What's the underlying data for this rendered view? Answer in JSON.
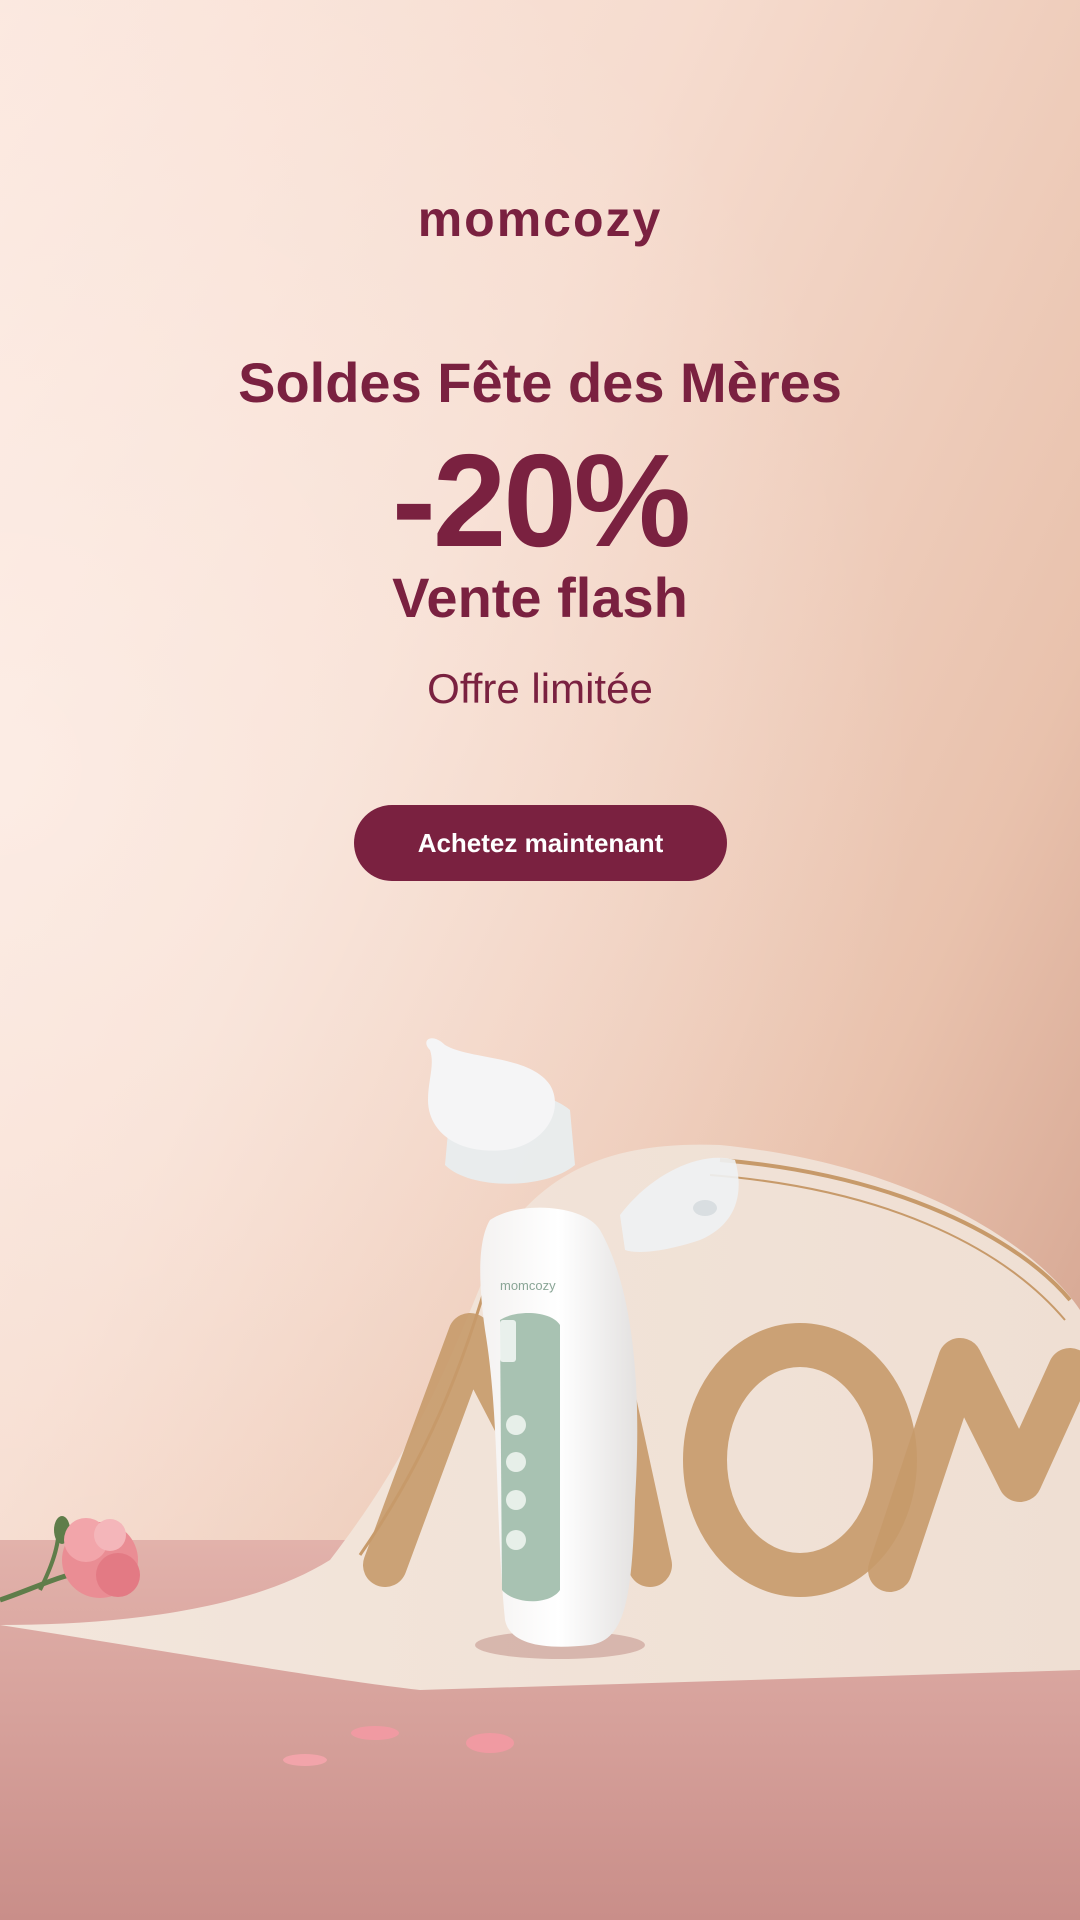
{
  "brand": {
    "name": "momcozy"
  },
  "promo": {
    "headline": "Soldes Fête des Mères",
    "discount": "-20%",
    "subheadline": "Vente flash",
    "note": "Offre limitée"
  },
  "cta": {
    "label": "Achetez maintenant"
  },
  "product": {
    "brand_label": "momcozy"
  },
  "banner_lettering": "MOM",
  "colors": {
    "accent": "#7a2140",
    "background": "#f6dccf",
    "product_panel": "#a8c2b2",
    "gold": "#c79a6a"
  }
}
